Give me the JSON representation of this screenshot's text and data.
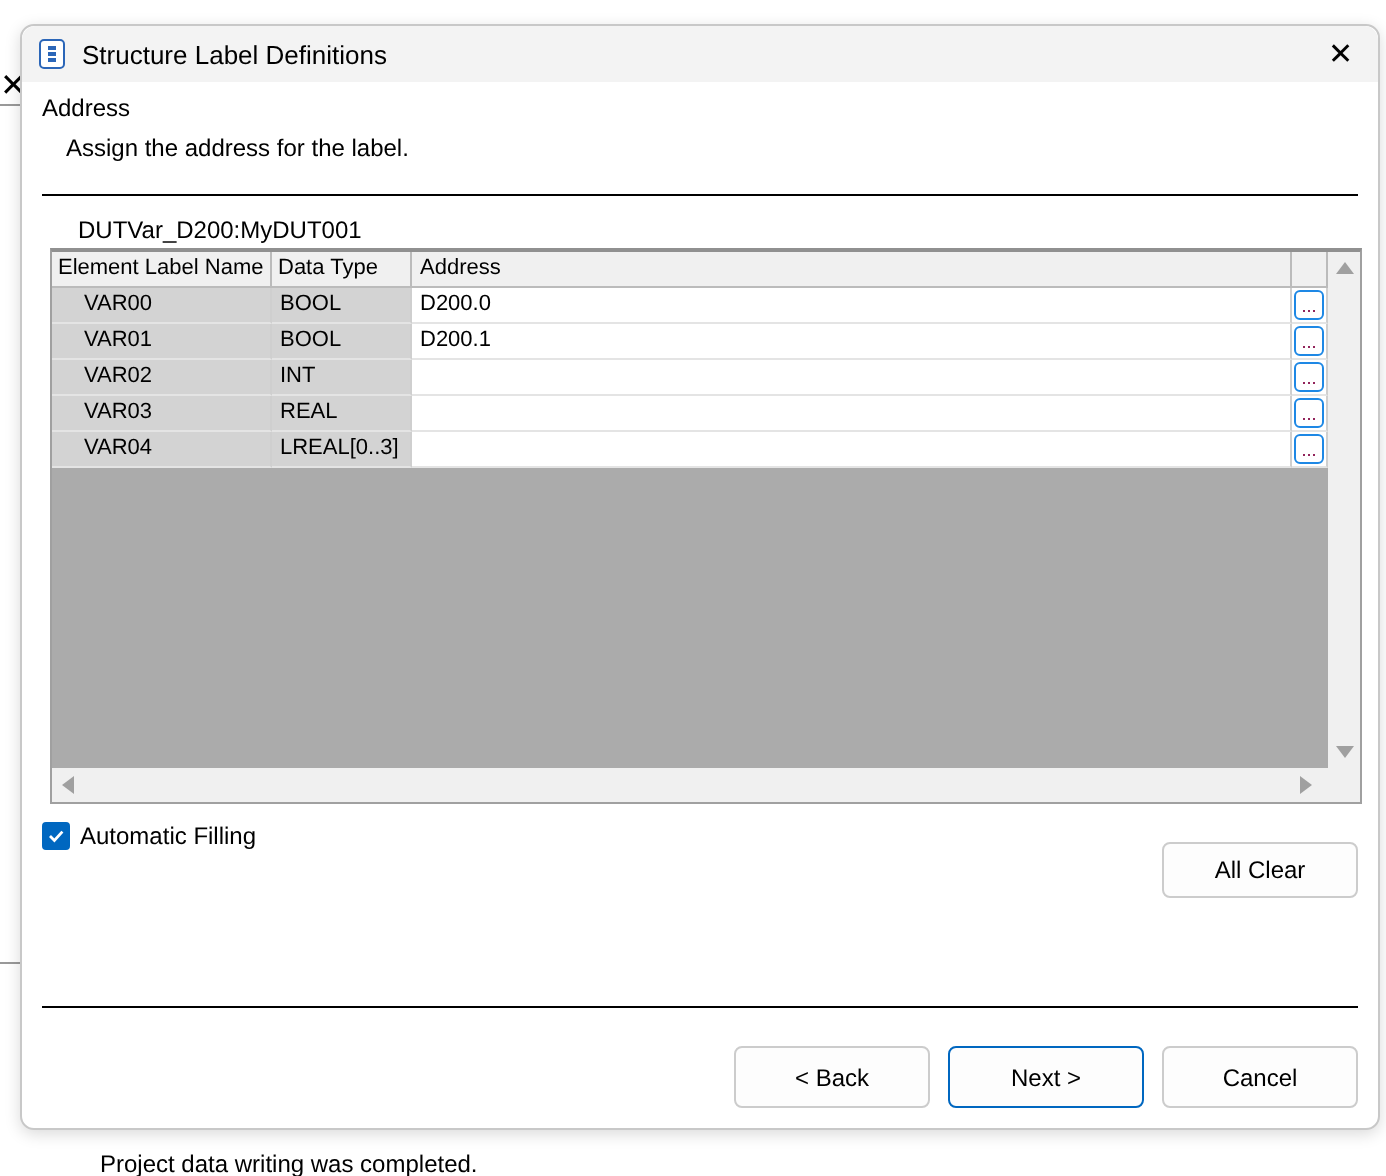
{
  "background": {
    "close_glyph": "✕",
    "status_message": "Project data writing was completed."
  },
  "window": {
    "title": "Structure Label Definitions",
    "close": "✕"
  },
  "header": {
    "title": "Address",
    "subtitle": "Assign the address for the label."
  },
  "group_label": "DUTVar_D200:MyDUT001",
  "table": {
    "columns": [
      "Element Label Name",
      "Data Type",
      "Address"
    ],
    "rows": [
      {
        "name": "VAR00",
        "type": "BOOL",
        "address": "D200.0",
        "browse": "..."
      },
      {
        "name": "VAR01",
        "type": "BOOL",
        "address": "D200.1",
        "browse": "..."
      },
      {
        "name": "VAR02",
        "type": "INT",
        "address": "",
        "browse": "..."
      },
      {
        "name": "VAR03",
        "type": "REAL",
        "address": "",
        "browse": "..."
      },
      {
        "name": "VAR04",
        "type": "LREAL[0..3]",
        "address": "",
        "browse": "..."
      }
    ]
  },
  "auto_filling": {
    "label": "Automatic Filling",
    "checked": true
  },
  "all_clear": "All Clear",
  "buttons": [
    {
      "label": "< Back",
      "default": false
    },
    {
      "label": "Next >",
      "default": true
    },
    {
      "label": "Cancel",
      "default": false
    }
  ]
}
